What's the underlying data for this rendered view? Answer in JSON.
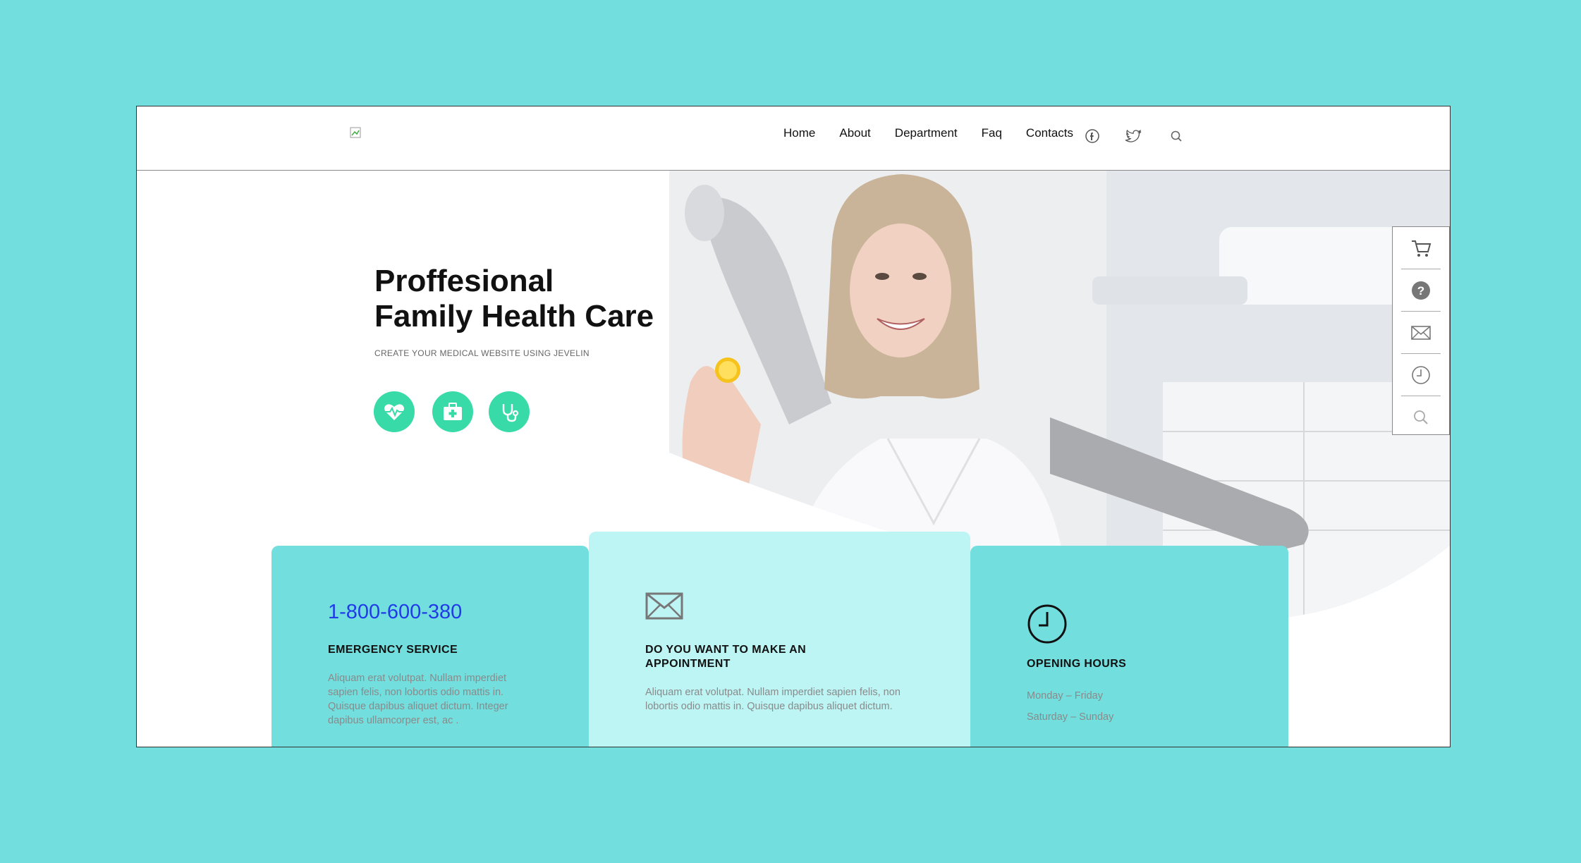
{
  "header": {
    "logo_alt": "",
    "nav": [
      "Home",
      "About",
      "Department",
      "Faq",
      "Contacts"
    ],
    "icons": [
      "facebook-icon",
      "twitter-icon",
      "search-icon"
    ]
  },
  "hero": {
    "title_line1": "Proffesional",
    "title_line2": "Family Health Care",
    "subtitle": "CREATE YOUR MEDICAL WEBSITE USING JEVELIN",
    "buttons": [
      "heart-pulse-icon",
      "medical-kit-icon",
      "stethoscope-icon"
    ]
  },
  "sidebar": {
    "items": [
      "cart-icon",
      "help-icon",
      "mail-icon",
      "clock-icon",
      "search-icon"
    ]
  },
  "cards": {
    "emergency": {
      "phone": "1-800-600-380",
      "title": "EMERGENCY SERVICE",
      "text": "Aliquam erat volutpat. Nullam imperdiet sapien felis, non lobortis odio mattis in. Quisque dapibus aliquet dictum. Integer dapibus ullamcorper est, ac ."
    },
    "appointment": {
      "title": "DO YOU WANT TO MAKE AN APPOINTMENT",
      "text": "Aliquam erat volutpat. Nullam imperdiet sapien felis, non lobortis odio mattis in. Quisque dapibus aliquet dictum."
    },
    "hours": {
      "title": "OPENING HOURS",
      "line1": "Monday – Friday",
      "line2": "Saturday – Sunday"
    }
  },
  "colors": {
    "page_bg": "#73dede",
    "accent_green": "#38dba8",
    "card_teal": "#73dede",
    "card_light": "#bdf5f5",
    "phone_blue": "#1f3ce8"
  }
}
